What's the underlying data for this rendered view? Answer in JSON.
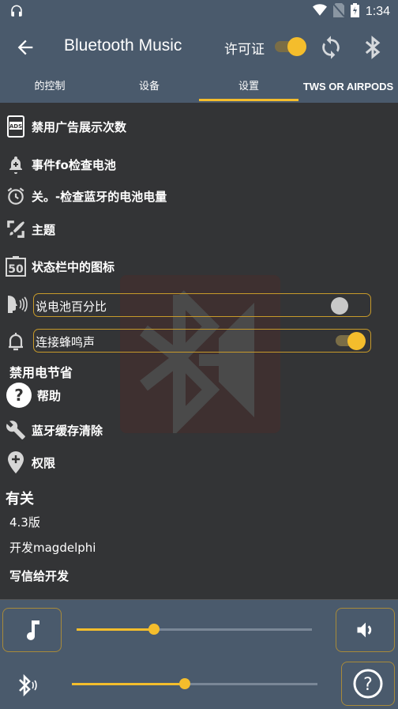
{
  "status_bar": {
    "time": "1:34",
    "icons": [
      "headphones-icon",
      "wifi-icon",
      "no-sim-icon",
      "battery-charging-icon"
    ]
  },
  "app_bar": {
    "title": "Bluetooth Music",
    "license_label": "许可证",
    "license_enabled": true
  },
  "tabs": [
    {
      "label": "的控制",
      "active": false
    },
    {
      "label": "设备",
      "active": false
    },
    {
      "label": "设置",
      "active": true
    },
    {
      "label": "TWS OR AIRPODS",
      "active": false
    }
  ],
  "settings": {
    "items": [
      {
        "label": "禁用广告展示次数",
        "icon": "ads-icon"
      },
      {
        "label": "事件fo检查电池",
        "icon": "bell-plus-icon"
      },
      {
        "label": "关。-检查蓝牙的电池电量",
        "icon": "alarm-clock-icon"
      },
      {
        "label": "主题",
        "icon": "theme-brush-icon"
      },
      {
        "label": "状态栏中的图标",
        "icon": "battery-50-icon"
      }
    ],
    "toggles": [
      {
        "label": "说电池百分比",
        "icon": "speak-icon",
        "on": false
      },
      {
        "label": "连接蜂鸣声",
        "icon": "bell-icon",
        "on": true
      }
    ],
    "battery_saver_label": "禁用电节省",
    "more_items": [
      {
        "label": "帮助",
        "icon": "help-circle-icon"
      },
      {
        "label": "蓝牙缓存清除",
        "icon": "wrench-icon"
      },
      {
        "label": "权限",
        "icon": "location-plus-icon"
      }
    ]
  },
  "about": {
    "heading": "有关",
    "version": "4.3版",
    "developer": "开发magdelphi",
    "contact": "写信给开发"
  },
  "bottom_controls": {
    "music_volume_fraction": 0.33,
    "bluetooth_volume_fraction": 0.46
  },
  "colors": {
    "accent": "#f4bd2c",
    "header_bg": "#4a5a6c",
    "content_bg": "#333436"
  }
}
